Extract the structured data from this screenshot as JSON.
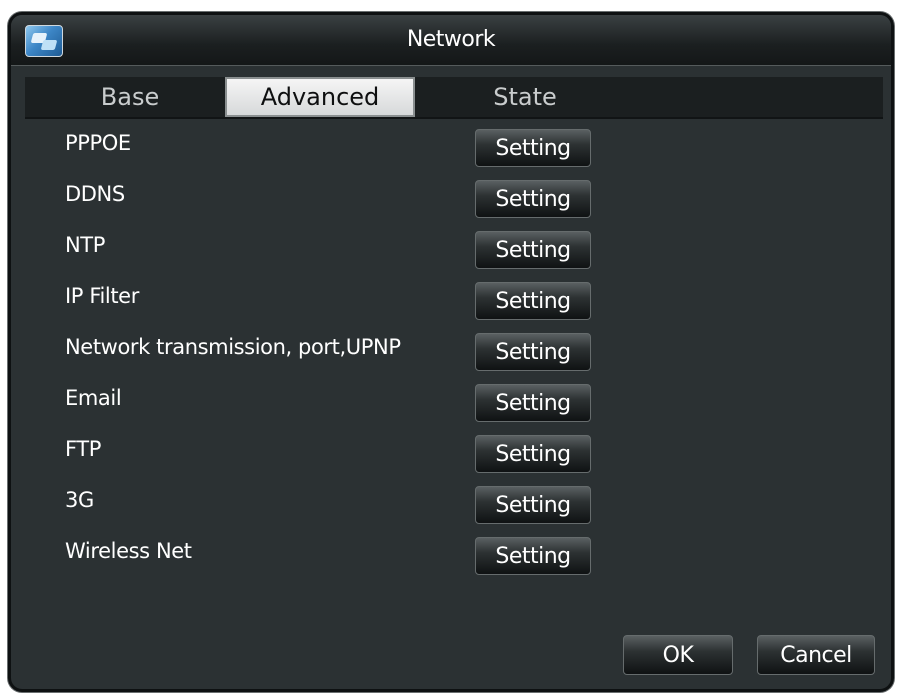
{
  "window": {
    "title": "Network",
    "icon": "network-app-icon"
  },
  "tabs": [
    {
      "label": "Base",
      "active": false
    },
    {
      "label": "Advanced",
      "active": true
    },
    {
      "label": "State",
      "active": false
    }
  ],
  "rows": [
    {
      "label": "PPPOE",
      "button": "Setting"
    },
    {
      "label": "DDNS",
      "button": "Setting"
    },
    {
      "label": "NTP",
      "button": "Setting"
    },
    {
      "label": "IP Filter",
      "button": "Setting"
    },
    {
      "label": "Network transmission, port,UPNP",
      "button": "Setting"
    },
    {
      "label": "Email",
      "button": "Setting"
    },
    {
      "label": "FTP",
      "button": "Setting"
    },
    {
      "label": "3G",
      "button": "Setting"
    },
    {
      "label": "Wireless Net",
      "button": "Setting"
    }
  ],
  "footer": {
    "ok_label": "OK",
    "cancel_label": "Cancel"
  },
  "colors": {
    "panel_background": "#2b3133",
    "titlebar": "#1b1f20",
    "active_tab": "#e8e9ea",
    "text": "#ffffff"
  }
}
